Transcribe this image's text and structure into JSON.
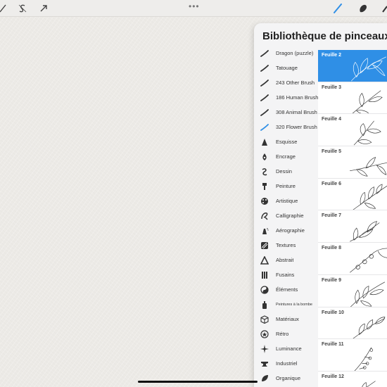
{
  "panel": {
    "title": "Bibliothèque de pinceaux"
  },
  "categories": [
    {
      "label": "Dragon (puzzle)",
      "icon": "stroke-icon"
    },
    {
      "label": "Tatouage",
      "icon": "stroke-icon"
    },
    {
      "label": "243 Other Brush",
      "icon": "stroke-icon"
    },
    {
      "label": "186 Human Brush",
      "icon": "stroke-icon"
    },
    {
      "label": "308 Animal Brush",
      "icon": "stroke-icon"
    },
    {
      "label": "320 Flower Brush",
      "icon": "stroke-icon",
      "selected": true
    },
    {
      "label": "Esquisse",
      "icon": "pencil-icon"
    },
    {
      "label": "Encrage",
      "icon": "ink-nib-icon"
    },
    {
      "label": "Dessin",
      "icon": "squiggle-icon"
    },
    {
      "label": "Peinture",
      "icon": "paintbrush-icon"
    },
    {
      "label": "Artistique",
      "icon": "palette-icon"
    },
    {
      "label": "Calligraphie",
      "icon": "calligraphy-icon"
    },
    {
      "label": "Aérographie",
      "icon": "airbrush-icon"
    },
    {
      "label": "Textures",
      "icon": "texture-icon"
    },
    {
      "label": "Abstrait",
      "icon": "triangle-icon"
    },
    {
      "label": "Fusains",
      "icon": "charcoal-icon"
    },
    {
      "label": "Éléments",
      "icon": "yin-yang-icon"
    },
    {
      "label": "Peintures à la bombe",
      "icon": "spray-can-icon"
    },
    {
      "label": "Matériaux",
      "icon": "cube-icon"
    },
    {
      "label": "Rétro",
      "icon": "star-badge-icon"
    },
    {
      "label": "Luminance",
      "icon": "sparkle-icon"
    },
    {
      "label": "Industriel",
      "icon": "anvil-icon"
    },
    {
      "label": "Organique",
      "icon": "leaf-icon"
    }
  ],
  "brushes": [
    {
      "name": "Feuille 2",
      "selected": true
    },
    {
      "name": "Feuille 3"
    },
    {
      "name": "Feuille 4"
    },
    {
      "name": "Feuille 5"
    },
    {
      "name": "Feuille 6"
    },
    {
      "name": "Feuille 7"
    },
    {
      "name": "Feuille 8"
    },
    {
      "name": "Feuille 9"
    },
    {
      "name": "Feuille 10"
    },
    {
      "name": "Feuille 11"
    },
    {
      "name": "Feuille 12"
    }
  ],
  "colors": {
    "accent": "#2f8fe6",
    "panel_bg": "#f4f4f5"
  }
}
